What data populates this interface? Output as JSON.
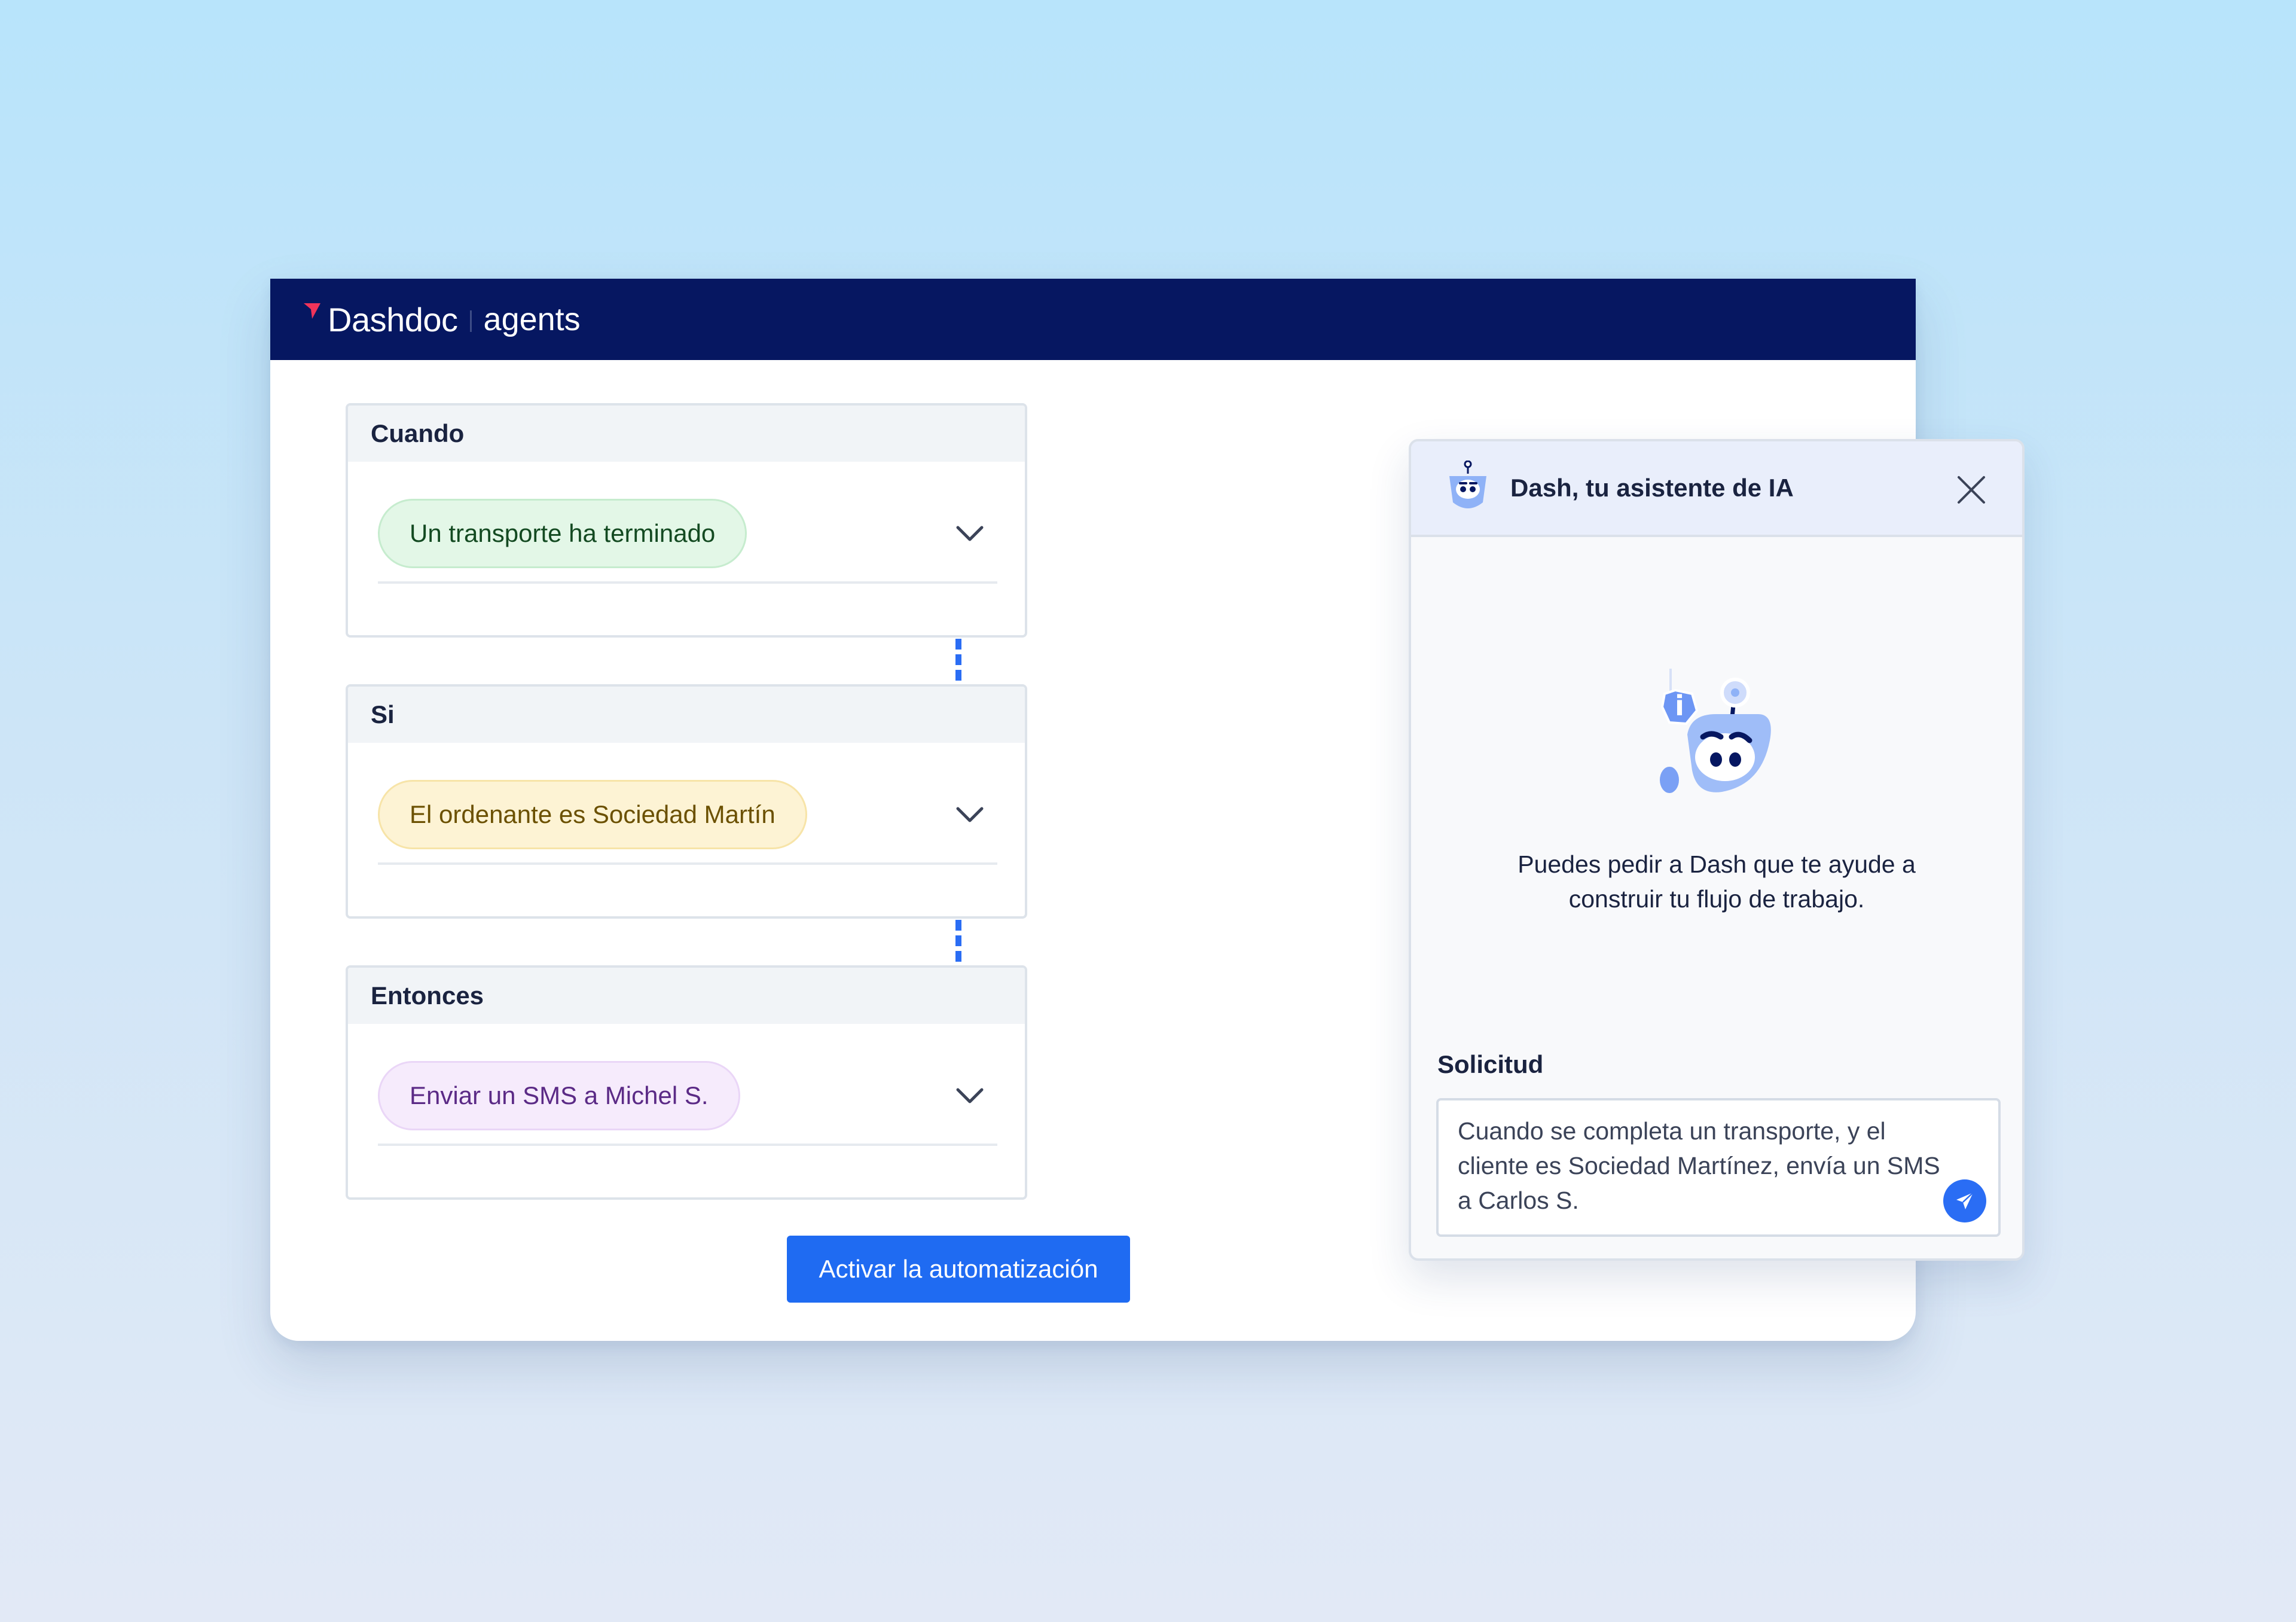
{
  "app": {
    "brand": "Dashdoc",
    "product": "agents"
  },
  "workflow": {
    "trigger": {
      "title": "Cuando",
      "value": "Un transporte ha terminado"
    },
    "condition": {
      "title": "Si",
      "value": "El ordenante es Sociedad Martín"
    },
    "action": {
      "title": "Entonces",
      "value": "Enviar un SMS a Michel S."
    },
    "activate_label": "Activar la automatización"
  },
  "assistant": {
    "title": "Dash, tu asistente de IA",
    "intro_line1": "Puedes pedir a Dash que te ayude a",
    "intro_line2": "construir tu flujo de trabajo.",
    "request_label": "Solicitud",
    "request_text": "Cuando se completa un transporte, y el cliente es Sociedad Martínez, envía un SMS a Carlos S.",
    "info_glyph": "i"
  },
  "icons": {
    "brand_mark": "dashdoc-logo-mark",
    "dropdown": "chevron-down-icon",
    "close": "close-icon",
    "send": "send-icon",
    "assistant_avatar": "robot-avatar-icon"
  },
  "colors": {
    "header_bg": "#061761",
    "primary": "#1f6bf2",
    "brand_mark": "#f0345a",
    "connector": "#2a6df4",
    "trigger_pill": "#e3f7e7",
    "condition_pill": "#fdf3d4",
    "action_pill": "#f6ebfc",
    "assistant_header": "#e9eefb"
  }
}
